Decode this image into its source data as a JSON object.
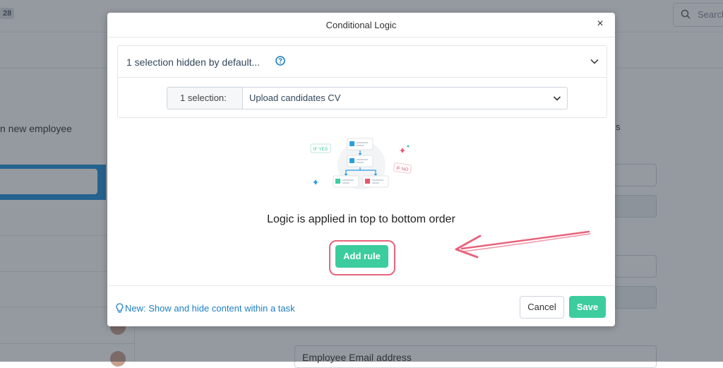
{
  "background": {
    "badge": "28",
    "search_placeholder": "Search",
    "sidebar_text": "n new employee",
    "right_field_char": "s",
    "email_field_label": "Employee Email address"
  },
  "modal": {
    "title": "Conditional Logic",
    "close_icon": "close-icon",
    "panel": {
      "title": "1 selection hidden by default...",
      "selection_prefix": "1  selection:",
      "selection_value": "Upload candidates CV"
    },
    "illustration": {
      "if_yes": "IF YES",
      "if_no": "IF NO"
    },
    "logic_text": "Logic is applied in top to bottom order",
    "add_rule_label": "Add rule",
    "footer": {
      "tip": "New: Show and hide content within a task",
      "cancel_label": "Cancel",
      "save_label": "Save"
    }
  },
  "colors": {
    "accent_green": "#3ccc9e",
    "highlight_pink": "#e8637c",
    "link_blue": "#1f7fc0"
  }
}
